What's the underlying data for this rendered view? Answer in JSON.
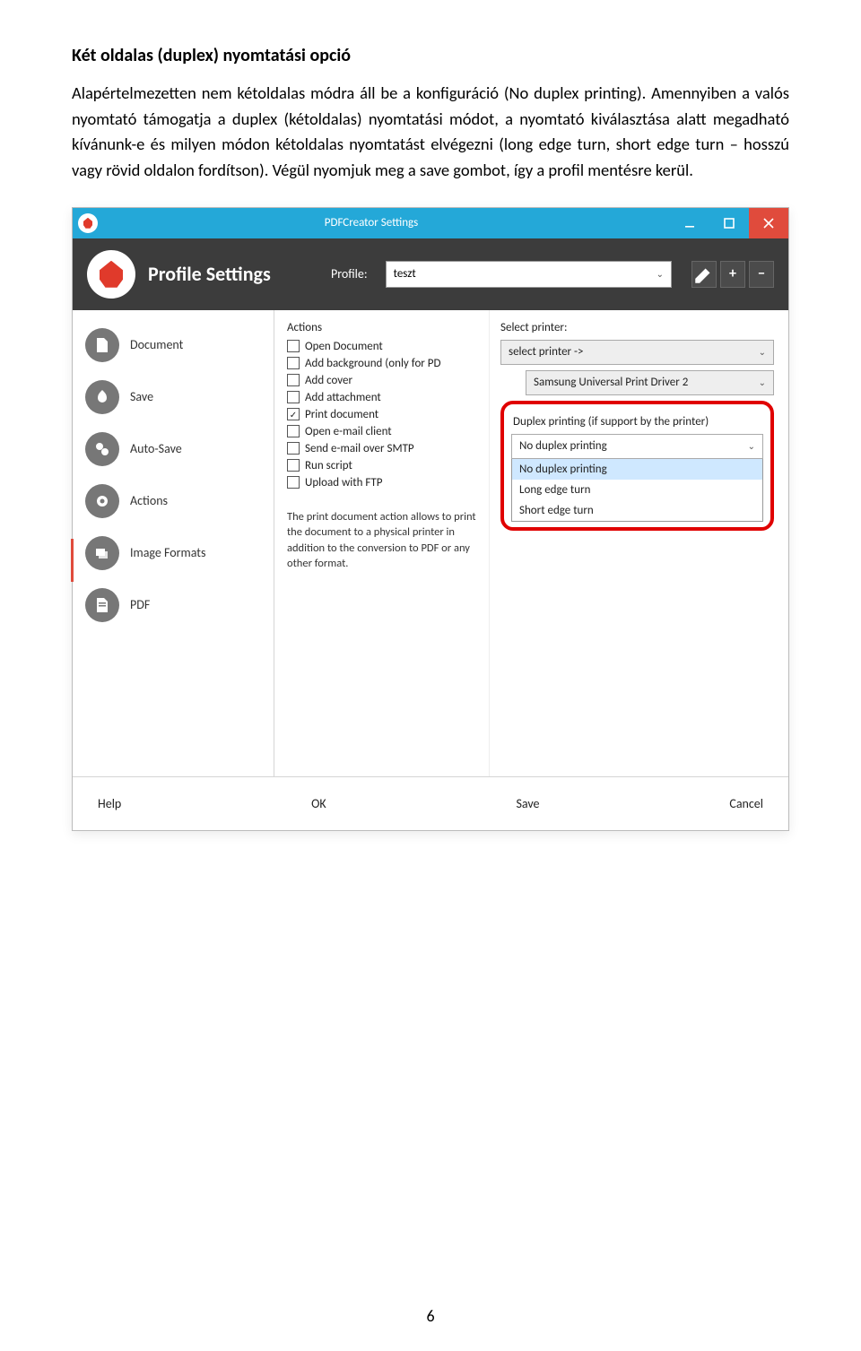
{
  "doc": {
    "heading": "Két oldalas (duplex) nyomtatási opció",
    "paragraph": "Alapértelmezetten nem kétoldalas módra áll be a konfiguráció (No duplex printing). Amennyiben a valós nyomtató támogatja a duplex (kétoldalas) nyomtatási módot, a nyomtató kiválasztása alatt megadható kívánunk-e és milyen módon kétoldalas nyomtatást elvégezni (long edge turn, short edge turn – hosszú vagy rövid oldalon fordítson). Végül nyomjuk meg a save gombot, így a profil mentésre kerül.",
    "page_number": "6"
  },
  "app": {
    "window_title": "PDFCreator Settings",
    "header_title": "Profile Settings",
    "profile_label": "Profile:",
    "profile_value": "teszt",
    "sidebar": [
      {
        "label": "Document"
      },
      {
        "label": "Save"
      },
      {
        "label": "Auto-Save"
      },
      {
        "label": "Actions"
      },
      {
        "label": "Image Formats"
      },
      {
        "label": "PDF"
      }
    ],
    "actions_label": "Actions",
    "actions": [
      {
        "label": "Open Document",
        "checked": false
      },
      {
        "label": "Add background (only for PD",
        "checked": false
      },
      {
        "label": "Add cover",
        "checked": false
      },
      {
        "label": "Add attachment",
        "checked": false
      },
      {
        "label": "Print document",
        "checked": true
      },
      {
        "label": "Open e-mail client",
        "checked": false
      },
      {
        "label": "Send e-mail over SMTP",
        "checked": false
      },
      {
        "label": "Run script",
        "checked": false
      },
      {
        "label": "Upload with FTP",
        "checked": false
      }
    ],
    "actions_desc": "The print document action allows to print the document to a physical printer in addition to the conversion to PDF or any other format.",
    "select_printer_label": "Select printer:",
    "select_printer_value": "select printer ->",
    "select_printer_sub": "Samsung Universal Print Driver 2",
    "duplex_label": "Duplex printing (if support by the printer)",
    "duplex_selected": "No duplex printing",
    "duplex_options": [
      "No duplex printing",
      "Long edge turn",
      "Short edge turn"
    ],
    "footer": {
      "help": "Help",
      "ok": "OK",
      "save": "Save",
      "cancel": "Cancel"
    }
  }
}
